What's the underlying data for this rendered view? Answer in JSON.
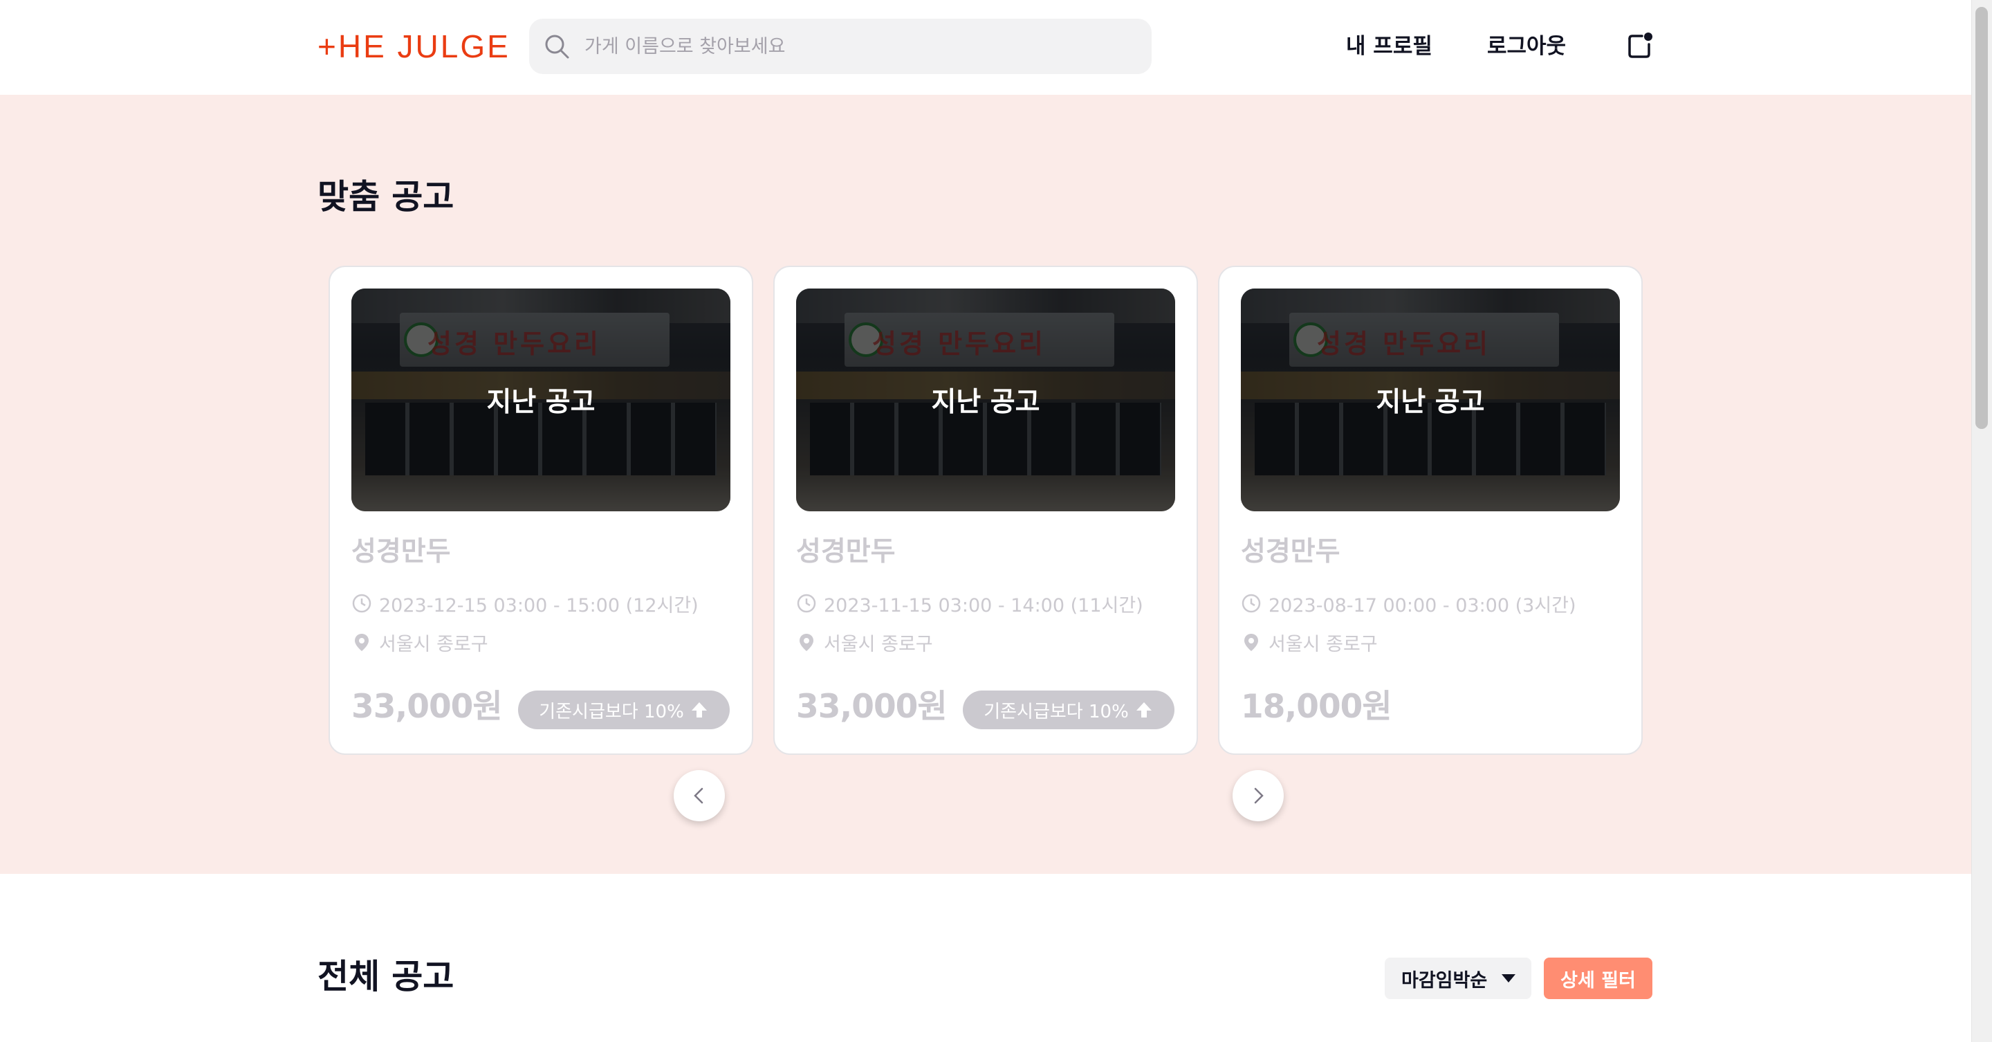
{
  "header": {
    "logo_text": "+HE JULGE",
    "search_placeholder": "가게 이름으로 찾아보세요",
    "nav": {
      "profile": "내 프로필",
      "logout": "로그아웃"
    }
  },
  "custom_section": {
    "title": "맞춤 공고",
    "cards": [
      {
        "closed_label": "지난 공고",
        "store_name": "성경만두",
        "time": "2023-12-15 03:00 - 15:00 (12시간)",
        "location": "서울시 종로구",
        "wage": "33,000원",
        "badge": "기존시급보다 10%"
      },
      {
        "closed_label": "지난 공고",
        "store_name": "성경만두",
        "time": "2023-11-15 03:00 - 14:00 (11시간)",
        "location": "서울시 종로구",
        "wage": "33,000원",
        "badge": "기존시급보다 10%"
      },
      {
        "closed_label": "지난 공고",
        "store_name": "성경만두",
        "time": "2023-08-17 00:00 - 03:00 (3시간)",
        "location": "서울시 종로구",
        "wage": "18,000원",
        "badge": ""
      }
    ]
  },
  "all_section": {
    "title": "전체 공고",
    "sort_selected": "마감임박순",
    "filter_label": "상세 필터"
  },
  "colors": {
    "brand": "#ea3c12",
    "section_bg": "#fbebe8",
    "filter_button": "#ff8d72",
    "disabled_text": "#cbc9cf"
  },
  "icons": [
    "search-icon",
    "bell-icon",
    "clock-icon",
    "location-pin-icon",
    "arrow-up-icon",
    "chevron-left-icon",
    "chevron-right-icon",
    "caret-down-icon"
  ]
}
